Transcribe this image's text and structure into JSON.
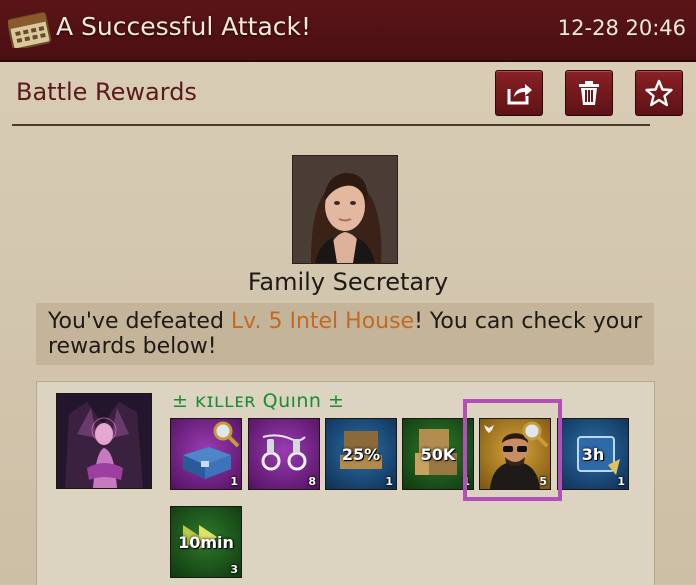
{
  "header": {
    "title": "A Successful Attack!",
    "time": "12-28 20:46"
  },
  "toolbar": {
    "section_title": "Battle Rewards"
  },
  "target": {
    "name": "Family Secretary"
  },
  "message": {
    "prefix": "You've defeated ",
    "highlight": "Lv. 5 Intel House",
    "suffix": "! You can check your rewards below!"
  },
  "reward": {
    "hero_name": "± ᴋɪʟʟᴇʀ Quınn ±",
    "items": [
      {
        "icon": "purple-chest",
        "label": "",
        "count": "1"
      },
      {
        "icon": "handcuffs",
        "label": "",
        "count": "8"
      },
      {
        "icon": "supply-boost",
        "label": "25%",
        "count": "1"
      },
      {
        "icon": "cash-crates",
        "label": "50K",
        "count": "1"
      },
      {
        "icon": "hero-shard",
        "label": "",
        "count": "5"
      },
      {
        "icon": "speedup-3h",
        "label": "3h",
        "count": "1"
      },
      {
        "icon": "speedup-10min",
        "label": "10min",
        "count": "3"
      }
    ]
  },
  "colors": {
    "header_bg": "#4a0f12",
    "accent_highlight": "#c36a22",
    "hero_name": "#1a8c34",
    "selection_border": "#b34fb8"
  }
}
